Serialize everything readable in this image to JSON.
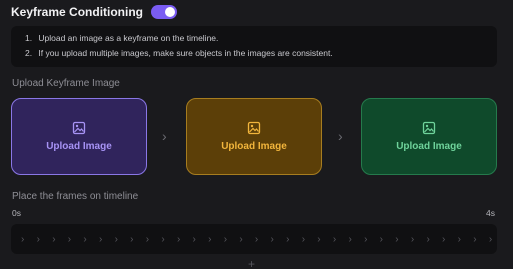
{
  "header": {
    "title": "Keyframe Conditioning",
    "toggle_on": true,
    "toggle_color": "#7a5cf2"
  },
  "instructions": [
    {
      "num": "1.",
      "text": "Upload an image as a keyframe on the timeline."
    },
    {
      "num": "2.",
      "text": "If you upload multiple images, make sure objects in the images are consistent."
    }
  ],
  "upload_section": {
    "label": "Upload Keyframe Image",
    "cards": [
      {
        "label": "Upload Image",
        "icon": "image-icon",
        "color": "#a793f5"
      },
      {
        "label": "Upload Image",
        "icon": "image-icon",
        "color": "#f2b53c"
      },
      {
        "label": "Upload Image",
        "icon": "image-icon",
        "color": "#6fd39b"
      }
    ],
    "arrow_icon": "chevron-right-icon"
  },
  "timeline_section": {
    "label": "Place the frames on timeline",
    "start_label": "0s",
    "end_label": "4s",
    "chevron_icon": "chevron-right-icon",
    "chevron_count": 31,
    "add_icon": "plus-icon"
  }
}
